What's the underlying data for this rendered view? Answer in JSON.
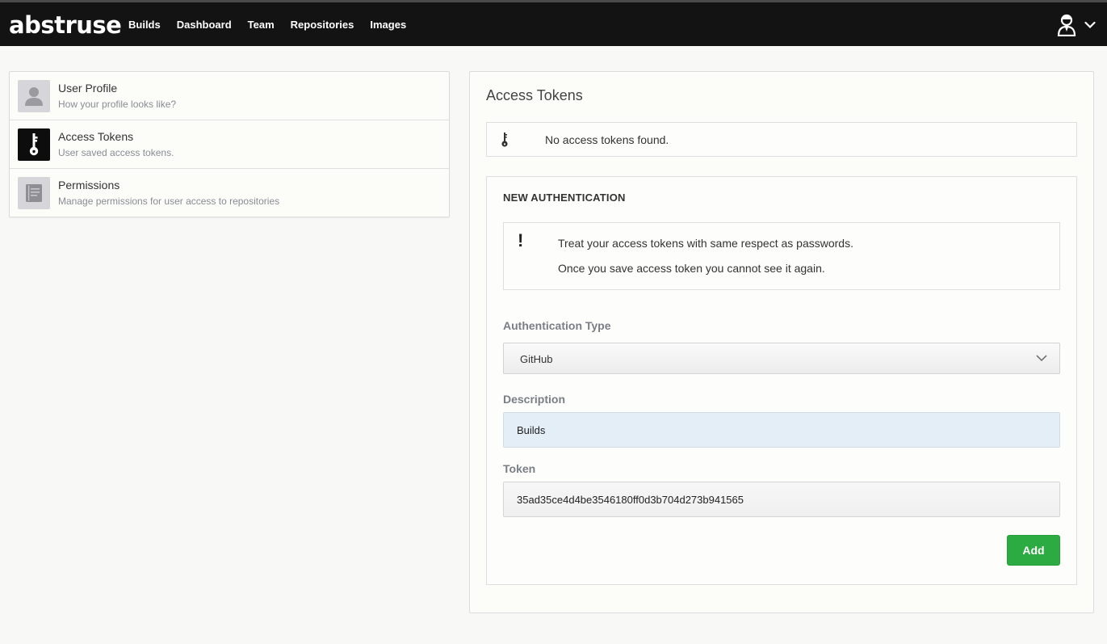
{
  "app": {
    "logo": "abstruse"
  },
  "nav": {
    "items": [
      {
        "label": "Builds"
      },
      {
        "label": "Dashboard"
      },
      {
        "label": "Team"
      },
      {
        "label": "Repositories"
      },
      {
        "label": "Images"
      }
    ]
  },
  "user_menu": {
    "icon": "user-avatar-icon",
    "caret": "chevron-down-icon"
  },
  "sidebar": {
    "items": [
      {
        "title": "User Profile",
        "subtitle": "How your profile looks like?",
        "icon": "user-icon",
        "active": false
      },
      {
        "title": "Access Tokens",
        "subtitle": "User saved access tokens.",
        "icon": "key-icon",
        "active": true
      },
      {
        "title": "Permissions",
        "subtitle": "Manage permissions for user access to repositories",
        "icon": "document-icon",
        "active": false
      }
    ]
  },
  "main": {
    "title": "Access Tokens",
    "empty_notice": "No access tokens found.",
    "form": {
      "heading": "NEW AUTHENTICATION",
      "warning": {
        "line1": "Treat your access tokens with same respect as passwords.",
        "line2": "Once you save access token you cannot see it again."
      },
      "auth_type_label": "Authentication Type",
      "auth_type_value": "GitHub",
      "description_label": "Description",
      "description_value": "Builds",
      "token_label": "Token",
      "token_value": "35ad35ce4d4be3546180ff0d3b704d273b941565",
      "add_label": "Add"
    }
  },
  "colors": {
    "topbar": "#131313",
    "accent_green": "#2cab42",
    "active_icon_bg": "#0d0d0d",
    "description_bg": "#e4eef6"
  }
}
